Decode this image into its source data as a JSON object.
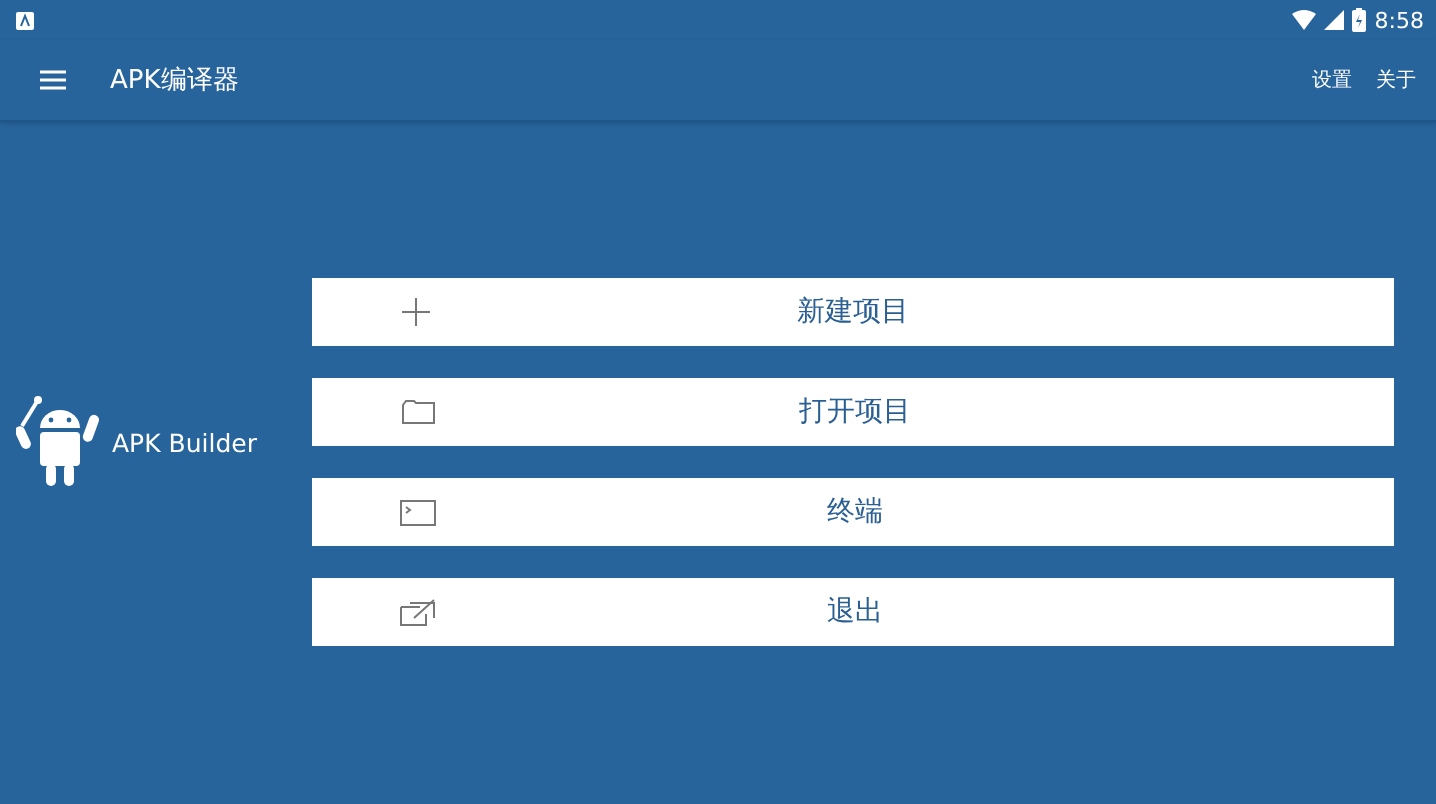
{
  "status_bar": {
    "time": "8:58"
  },
  "toolbar": {
    "title": "APK编译器",
    "actions": [
      "设置",
      "关于"
    ]
  },
  "brand": {
    "name": "APK Builder"
  },
  "menu": [
    {
      "kind": "new",
      "label": "新建项目"
    },
    {
      "kind": "open",
      "label": "打开项目"
    },
    {
      "kind": "terminal",
      "label": "终端"
    },
    {
      "kind": "exit",
      "label": "退出"
    }
  ]
}
